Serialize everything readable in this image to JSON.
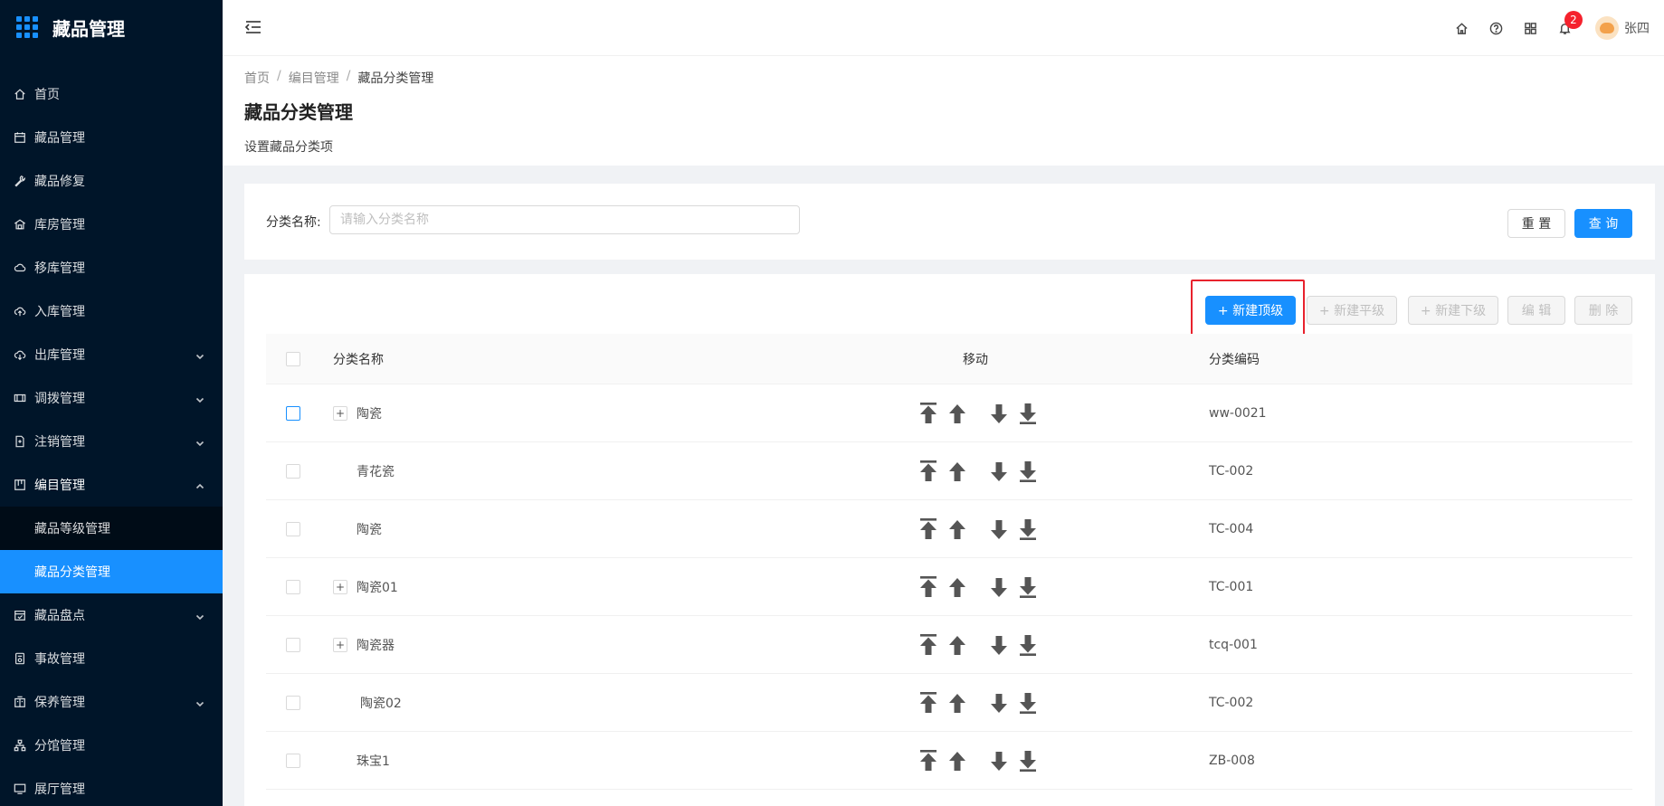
{
  "app": {
    "title": "藏品管理"
  },
  "sidebar": {
    "items": [
      {
        "label": "首页",
        "icon": "home-icon"
      },
      {
        "label": "藏品管理",
        "icon": "calendar-icon"
      },
      {
        "label": "藏品修复",
        "icon": "wrench-icon"
      },
      {
        "label": "库房管理",
        "icon": "warehouse-icon"
      },
      {
        "label": "移库管理",
        "icon": "cloud-icon"
      },
      {
        "label": "入库管理",
        "icon": "cloud-upload-icon"
      },
      {
        "label": "出库管理",
        "icon": "cloud-download-icon",
        "expandable": true
      },
      {
        "label": "调拨管理",
        "icon": "transfer-icon",
        "expandable": true
      },
      {
        "label": "注销管理",
        "icon": "file-icon",
        "expandable": true
      },
      {
        "label": "编目管理",
        "icon": "catalog-icon",
        "expandable": true,
        "open": true,
        "children": [
          {
            "label": "藏品等级管理",
            "active": false
          },
          {
            "label": "藏品分类管理",
            "active": true
          }
        ]
      },
      {
        "label": "藏品盘点",
        "icon": "inventory-icon",
        "expandable": true
      },
      {
        "label": "事故管理",
        "icon": "incident-icon"
      },
      {
        "label": "保养管理",
        "icon": "building-icon",
        "expandable": true
      },
      {
        "label": "分馆管理",
        "icon": "branch-icon"
      },
      {
        "label": "展厅管理",
        "icon": "monitor-icon"
      }
    ]
  },
  "header": {
    "notification_count": "2",
    "user_name": "张四"
  },
  "breadcrumb": [
    "首页",
    "编目管理",
    "藏品分类管理"
  ],
  "page": {
    "title": "藏品分类管理",
    "description": "设置藏品分类项"
  },
  "search": {
    "label": "分类名称:",
    "placeholder": "请输入分类名称",
    "value": "",
    "reset_label": "重 置",
    "query_label": "查 询"
  },
  "toolbar": {
    "new_top_label": "+ 新建顶级",
    "new_sibling_label": "+ 新建平级",
    "new_child_label": "+ 新建下级",
    "edit_label": "编 辑",
    "delete_label": "删 除"
  },
  "table": {
    "columns": [
      "分类名称",
      "移动",
      "分类编码"
    ],
    "rows": [
      {
        "name": "陶瓷",
        "code": "ww-0021",
        "expandable": true,
        "level": 0
      },
      {
        "name": "青花瓷",
        "code": "TC-002",
        "expandable": false,
        "level": 1
      },
      {
        "name": "陶瓷",
        "code": "TC-004",
        "expandable": false,
        "level": 1
      },
      {
        "name": "陶瓷01",
        "code": "TC-001",
        "expandable": true,
        "level": 0
      },
      {
        "name": "陶瓷器",
        "code": "tcq-001",
        "expandable": true,
        "level": 0
      },
      {
        "name": "陶瓷02",
        "code": "TC-002",
        "expandable": false,
        "level": 2
      },
      {
        "name": "珠宝1",
        "code": "ZB-008",
        "expandable": false,
        "level": 1
      }
    ]
  },
  "colors": {
    "sidebar_bg": "#001529",
    "submenu_bg": "#000c17",
    "primary": "#1890ff",
    "highlight_border": "#e8222d",
    "badge": "#f5222d"
  }
}
